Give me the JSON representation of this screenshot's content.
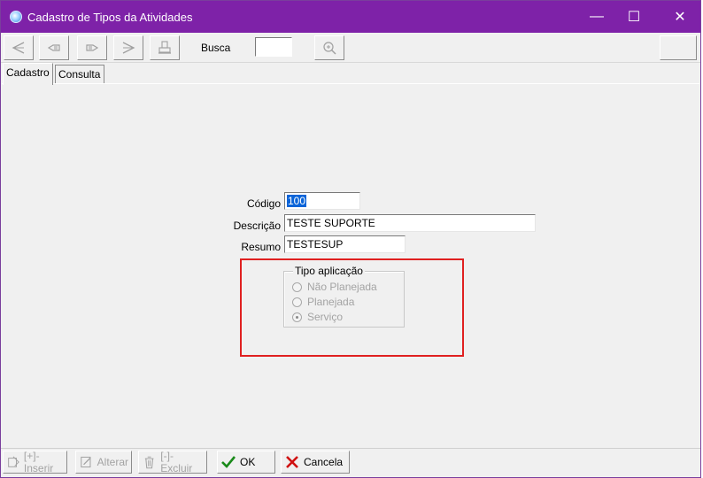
{
  "window": {
    "title": "Cadastro de Tipos da Atividades",
    "min_glyph": "—",
    "max_glyph": "☐",
    "close_glyph": "✕"
  },
  "toolbar": {
    "busca_label": "Busca",
    "busca_value": ""
  },
  "tabs": [
    {
      "label": "Cadastro",
      "active": true
    },
    {
      "label": "Consulta",
      "active": false
    }
  ],
  "form": {
    "codigo_label": "Código",
    "codigo_value": "100",
    "descricao_label": "Descrição",
    "descricao_value": "TESTE SUPORTE",
    "resumo_label": "Resumo",
    "resumo_value": "TESTESUP"
  },
  "tipo_aplicacao": {
    "title": "Tipo aplicação",
    "options": [
      {
        "label": "Não Planejada",
        "checked": false
      },
      {
        "label": "Planejada",
        "checked": false
      },
      {
        "label": "Serviço",
        "checked": true
      }
    ]
  },
  "bottom": {
    "inserir": "[+]-Inserir",
    "alterar": "Alterar",
    "excluir": "[-]-Excluir",
    "ok": "OK",
    "cancela": "Cancela"
  },
  "colors": {
    "titlebar": "#7e22a8",
    "highlight_box": "#e02020",
    "selection": "#0a64d8",
    "ok_check": "#1a8a1a",
    "cancel_x": "#d01010"
  }
}
